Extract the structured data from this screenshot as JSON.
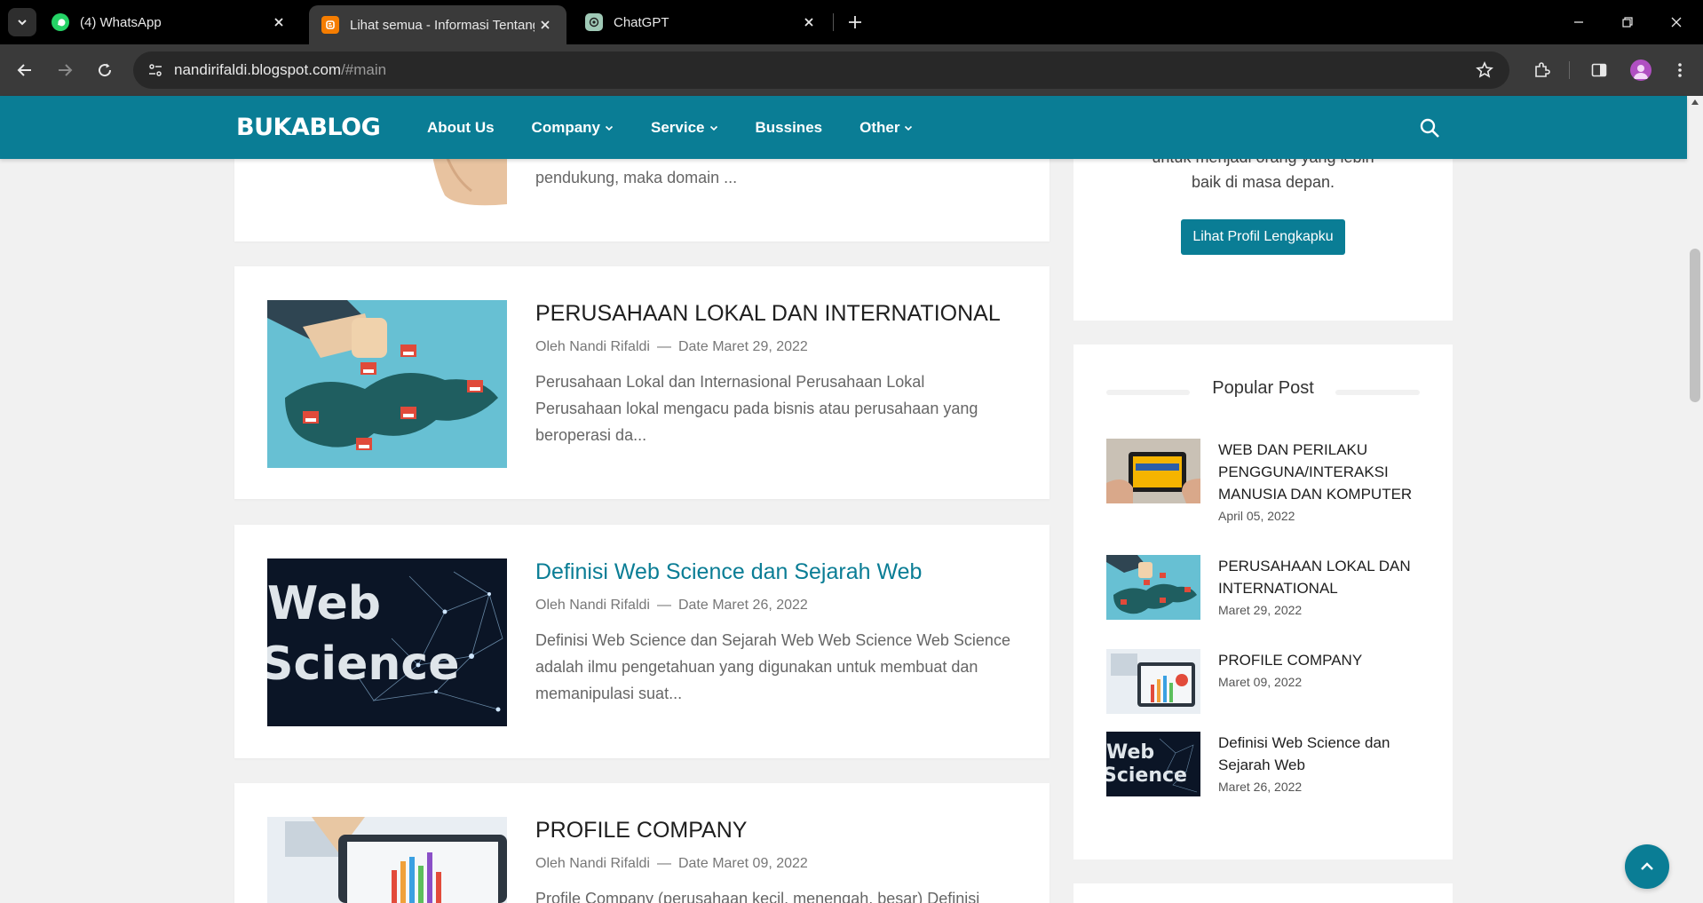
{
  "browser": {
    "tabs": [
      {
        "title": "(4) WhatsApp",
        "icon": "whatsapp-icon",
        "active": false
      },
      {
        "title": "Lihat semua - Informasi Tentang",
        "icon": "blogger-icon",
        "active": true
      },
      {
        "title": "ChatGPT",
        "icon": "chatgpt-icon",
        "active": false
      }
    ],
    "url_host": "nandirifaldi.blogspot.com",
    "url_rest": "/#main"
  },
  "site": {
    "logo": "BUKABLOG",
    "nav": [
      {
        "label": "About Us",
        "dropdown": false
      },
      {
        "label": "Company",
        "dropdown": true
      },
      {
        "label": "Service",
        "dropdown": true
      },
      {
        "label": "Bussines",
        "dropdown": false
      },
      {
        "label": "Other",
        "dropdown": true
      }
    ],
    "accent": "#0a7d95"
  },
  "posts": [
    {
      "title": "",
      "author": "",
      "date": "",
      "excerpt": "pendukung, maka domain ..."
    },
    {
      "title": "PERUSAHAAN LOKAL DAN INTERNATIONAL",
      "author": "Oleh Nandi Rifaldi",
      "date": "Date Maret 29, 2022",
      "excerpt": "Perusahaan Lokal dan Internasional   Perusahaan Lokal Perusahaan lokal mengacu pada bisnis atau perusahaan yang beroperasi da..."
    },
    {
      "title": "Definisi Web Science dan Sejarah Web",
      "author": "Oleh Nandi Rifaldi",
      "date": "Date Maret 26, 2022",
      "excerpt": "Definisi Web Science dan Sejarah Web   Web Science Web Science adalah ilmu pengetahuan yang digunakan untuk membuat dan memanipulasi suat..."
    },
    {
      "title": "PROFILE COMPANY",
      "author": "Oleh Nandi Rifaldi",
      "date": "Date Maret 09, 2022",
      "excerpt": "Profile Company (perusahaan kecil, menengah, besar)    Definisi"
    }
  ],
  "thumb_text": {
    "web": "Web",
    "science": "Science"
  },
  "profile": {
    "text_line1": "untuk menjadi orang yang lebih",
    "text_line2": "baik di masa depan.",
    "button": "Lihat Profil Lengkapku"
  },
  "popular": {
    "title": "Popular Post",
    "items": [
      {
        "title": "WEB DAN PERILAKU PENGGUNA/INTERAKSI MANUSIA DAN KOMPUTER",
        "date": "April 05, 2022"
      },
      {
        "title": "PERUSAHAAN LOKAL DAN INTERNATIONAL",
        "date": "Maret 29, 2022"
      },
      {
        "title": "PROFILE COMPANY",
        "date": "Maret 09, 2022"
      },
      {
        "title": "Definisi Web Science dan Sejarah Web",
        "date": "Maret 26, 2022"
      }
    ]
  }
}
